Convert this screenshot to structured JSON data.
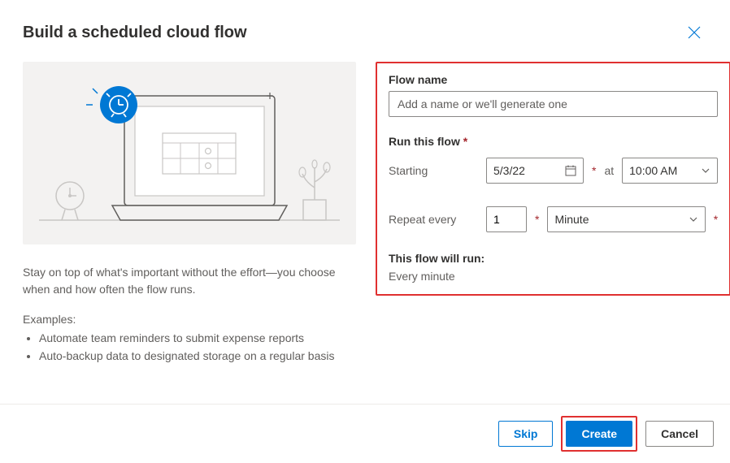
{
  "dialog": {
    "title": "Build a scheduled cloud flow",
    "description": "Stay on top of what's important without the effort—you choose when and how often the flow runs.",
    "examples_label": "Examples:",
    "examples": [
      "Automate team reminders to submit expense reports",
      "Auto-backup data to designated storage on a regular basis"
    ]
  },
  "form": {
    "flow_name_label": "Flow name",
    "flow_name_placeholder": "Add a name or we'll generate one",
    "run_label": "Run this flow",
    "starting_label": "Starting",
    "starting_date": "5/3/22",
    "at_label": "at",
    "starting_time": "10:00 AM",
    "repeat_label": "Repeat every",
    "repeat_value": "1",
    "repeat_unit": "Minute",
    "summary_label": "This flow will run:",
    "summary_text": "Every minute"
  },
  "footer": {
    "skip": "Skip",
    "create": "Create",
    "cancel": "Cancel"
  }
}
